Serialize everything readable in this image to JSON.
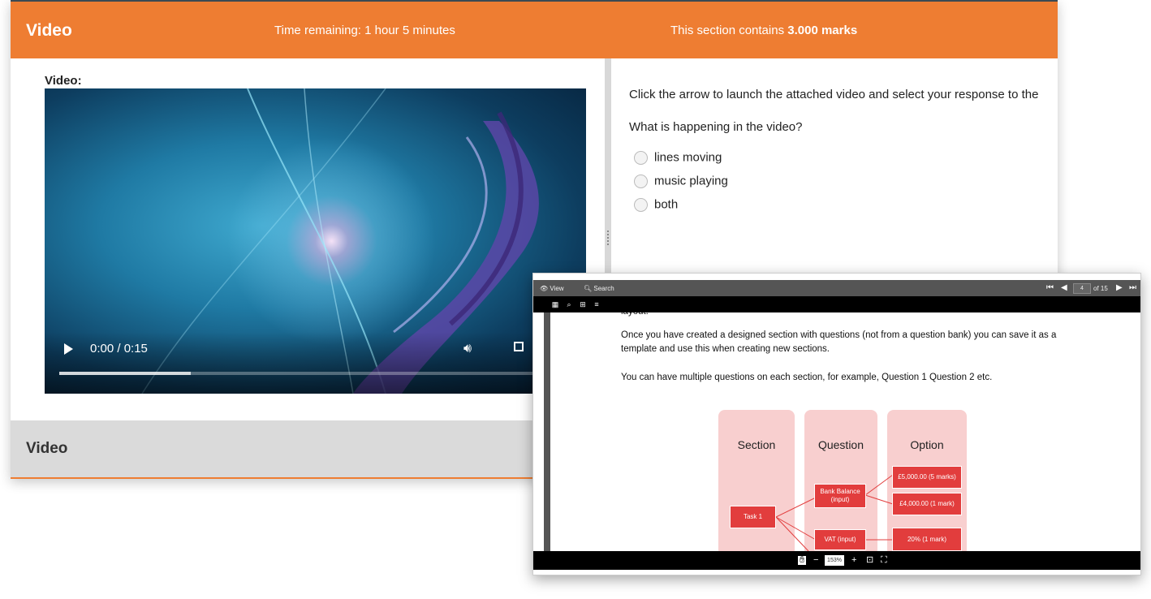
{
  "header": {
    "title": "Video",
    "time_remaining": "Time remaining: 1 hour 5 minutes",
    "marks_prefix": "This section contains ",
    "marks_value": "3.000 marks"
  },
  "video_panel": {
    "label": "Video:",
    "player": {
      "time": "0:00 / 0:15",
      "progress_fraction": 0.276
    }
  },
  "question_panel": {
    "instructions": "Click the arrow to launch the attached video and select your response to the",
    "question": "What is happening in the video?",
    "options": [
      "lines moving",
      "music playing",
      "both"
    ]
  },
  "footer": {
    "section_title": "Video"
  },
  "doc_viewer": {
    "menu": {
      "view": "View",
      "search": "Search"
    },
    "page_current": "4",
    "page_total": "of 15",
    "zoom": "153%",
    "page_fragment": "layout.",
    "paragraphs": [
      "Once you have created a designed section with questions (not from a question bank) you can save it as a template and use this when creating new sections.",
      "You can have multiple questions on each section, for example, Question 1 Question 2 etc."
    ],
    "diagram": {
      "columns": [
        "Section",
        "Question",
        "Option"
      ],
      "nodes": {
        "task": "Task 1",
        "bank": "Bank Balance (input)",
        "vat": "VAT (input)",
        "opt1": "£5,000.00 (5 marks)",
        "opt2": "£4,000.00 (1 mark)",
        "opt3": "20% (1 mark)"
      }
    }
  },
  "colors": {
    "accent": "#ee7d32",
    "node_red": "#e23d3d",
    "column_pink": "#f8cfcf"
  }
}
